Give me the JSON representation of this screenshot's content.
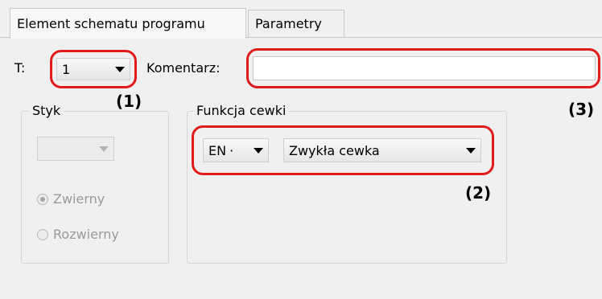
{
  "tabs": [
    {
      "label": "Element schematu programu",
      "active": true
    },
    {
      "label": "Parametry",
      "active": false
    }
  ],
  "top_row": {
    "t_label": "T:",
    "t_value": "1",
    "comment_label": "Komentarz:",
    "comment_value": ""
  },
  "styk": {
    "title": "Styk",
    "combo_value": "",
    "options": [
      "Zwierny",
      "Rozwierny"
    ],
    "selected": "Zwierny"
  },
  "funkcja": {
    "title": "Funkcja cewki",
    "en_value": "EN",
    "en_dot": "·",
    "coil_value": "Zwykła cewka"
  },
  "annotations": [
    "(1)",
    "(2)",
    "(3)"
  ],
  "colors": {
    "annotation": "#e01b1b",
    "window_bg": "#f0f0f0"
  }
}
